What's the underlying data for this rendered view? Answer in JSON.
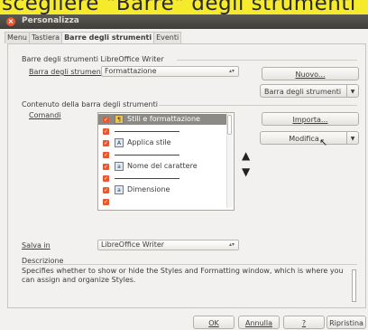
{
  "banner_text": "scegliere \"Barre\" degli strumenti",
  "window": {
    "title": "Personalizza"
  },
  "tabs": [
    "Menu",
    "Tastiera",
    "Barre degli strumenti",
    "Eventi"
  ],
  "toolbars_section": {
    "title": "Barre degli strumenti LibreOffice Writer",
    "label": "Barra degli strumenti",
    "selected": "Formattazione",
    "new_button": "Nuovo...",
    "menu_button": "Barra degli strumenti"
  },
  "content_section": {
    "title": "Contenuto della barra degli strumenti",
    "commands_label": "Comandi",
    "items": [
      {
        "label": "Stili e formattazione",
        "type": "command",
        "icon": "styles-icon",
        "selected": true
      },
      {
        "label": "",
        "type": "separator"
      },
      {
        "label": "Applica stile",
        "type": "command",
        "icon": "apply-style-icon"
      },
      {
        "label": "",
        "type": "separator"
      },
      {
        "label": "Nome del carattere",
        "type": "command",
        "icon": "font-name-icon"
      },
      {
        "label": "",
        "type": "separator"
      },
      {
        "label": "Dimensione",
        "type": "command",
        "icon": "font-size-icon"
      },
      {
        "label": "",
        "type": "separator"
      }
    ],
    "import_button": "Importa...",
    "modify_button": "Modifica"
  },
  "save_in": {
    "label": "Salva in",
    "value": "LibreOffice Writer"
  },
  "description": {
    "label": "Descrizione",
    "text": "Specifies whether to show or hide the Styles and Formatting window, which is where you can assign and organize Styles."
  },
  "footer": {
    "ok": "OK",
    "cancel": "Annulla",
    "help": "?",
    "reset": "Ripristina"
  }
}
